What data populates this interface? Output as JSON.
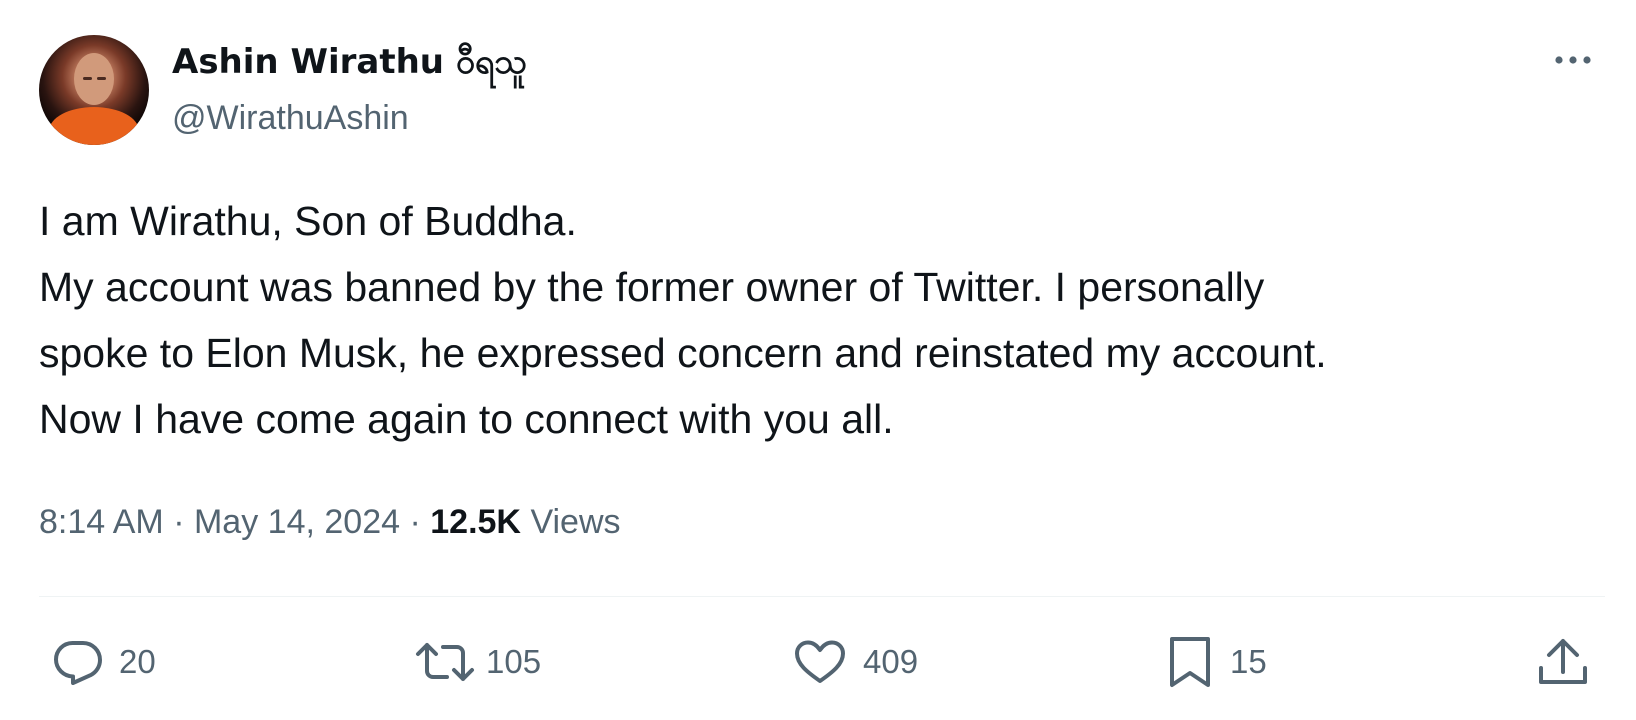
{
  "author": {
    "display_name": "Ashin Wirathu ဝီရသူ",
    "handle": "@WirathuAshin"
  },
  "tweet": {
    "lines": [
      "I am Wirathu, Son of Buddha.",
      "My account was banned by the former owner of Twitter. I personally",
      "spoke to Elon Musk, he expressed concern and reinstated my account.",
      "Now I have come again to connect with you all."
    ],
    "time": "8:14 AM",
    "separator": "·",
    "date": "May 14, 2024",
    "views_count": "12.5K",
    "views_label": "Views"
  },
  "actions": {
    "replies": "20",
    "reposts": "105",
    "likes": "409",
    "bookmarks": "15"
  },
  "icons": {
    "avatar": "avatar-photo",
    "more": "more-horizontal-icon",
    "reply": "reply-icon",
    "repost": "repost-icon",
    "like": "heart-icon",
    "bookmark": "bookmark-icon",
    "share": "share-icon"
  },
  "colors": {
    "text_primary": "#0f1419",
    "text_secondary": "#536471",
    "divider": "#eff3f4"
  }
}
